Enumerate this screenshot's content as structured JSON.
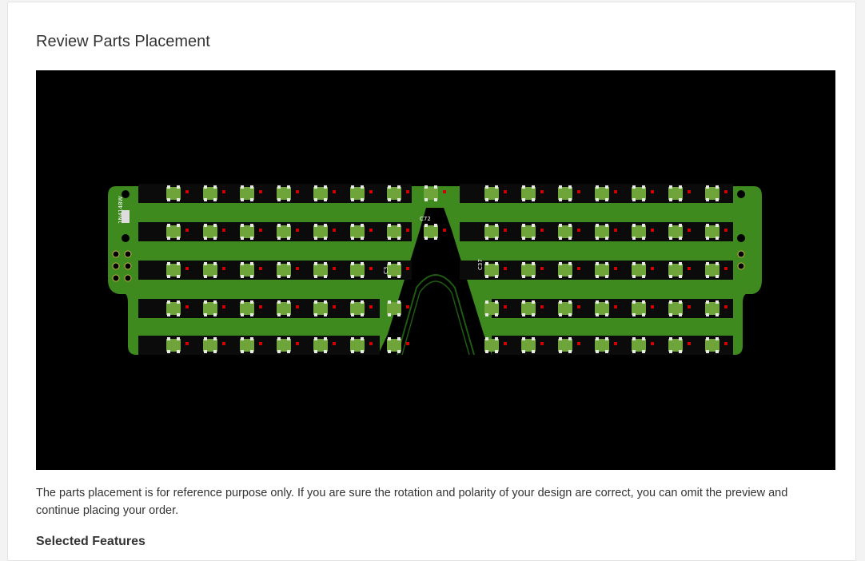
{
  "page": {
    "title": "Review Parts Placement",
    "note": "The parts placement is for reference purpose only. If you are sure the rotation and polarity of your design are correct, you can omit the preview and continue placing your order.",
    "next_section_heading": "Selected Features"
  },
  "board": {
    "colors": {
      "background": "#000000",
      "pcb_green": "#3e8a1f",
      "pcb_dark_green": "#1f5a12",
      "led_strip": "#0b0b0b",
      "led_pad": "#e8e8e8",
      "marker_red": "#d00000",
      "cap_body": "#6ea43a"
    },
    "labels": {
      "diode": "1N4148W",
      "cap_bridge_left": "C72",
      "cap_mid_left": "C3",
      "cap_mid_right": "C37"
    },
    "led_rows": 5,
    "led_columns_per_side": 7
  }
}
